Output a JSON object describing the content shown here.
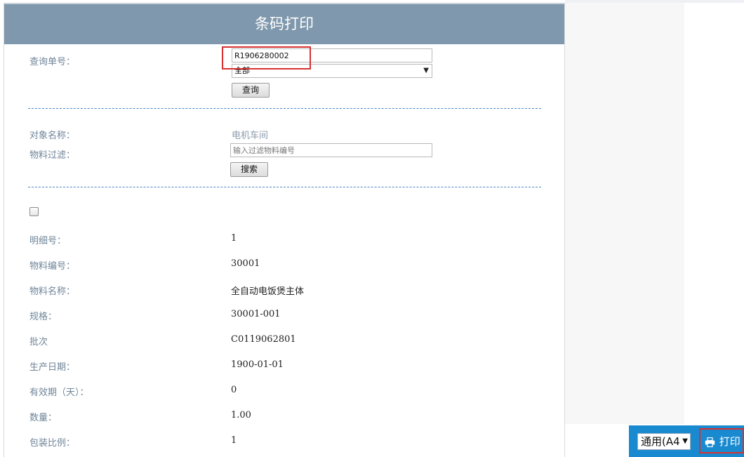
{
  "header": {
    "title": "条码打印"
  },
  "query": {
    "label": "查询单号：",
    "order_no": "R1906280002",
    "scope_selected": "全部",
    "query_button": "查询"
  },
  "filter": {
    "object_label": "对象名称：",
    "object_value": "电机车间",
    "material_filter_label": "物料过滤：",
    "material_filter_placeholder": "输入过滤物料编号",
    "search_button": "搜索"
  },
  "detail": {
    "select_all_checked": false,
    "fields": [
      {
        "label": "明细号：",
        "value": "1"
      },
      {
        "label": "物料编号：",
        "value": "30001"
      },
      {
        "label": "物料名称：",
        "value": "全自动电饭煲主体"
      },
      {
        "label": "规格：",
        "value": "30001-001"
      },
      {
        "label": "批次",
        "value": "C0119062801"
      },
      {
        "label": "生产日期：",
        "value": "1900-01-01"
      },
      {
        "label": "有效期（天）：",
        "value": "0"
      },
      {
        "label": "数量：",
        "value": "1.00"
      },
      {
        "label": "包装比例：",
        "value": "1"
      }
    ]
  },
  "toolbar": {
    "template_selected": "通用(A4",
    "print_button": "打印"
  },
  "colors": {
    "header_bg": "#7f98ad",
    "label_text": "#6f8599",
    "divider": "#4a86c4",
    "highlight": "#d83030",
    "toolbar_bg": "#1a8ad0"
  }
}
